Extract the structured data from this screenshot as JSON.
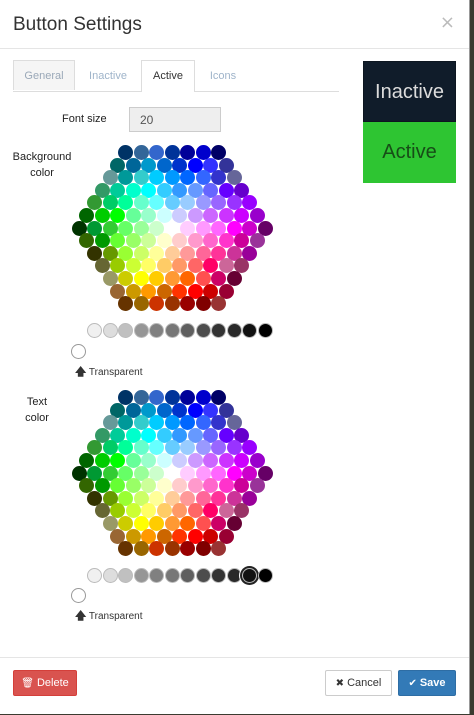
{
  "dialog": {
    "title": "Button Settings",
    "close_glyph": "×"
  },
  "tabs": [
    {
      "label": "General",
      "state": "inactive"
    },
    {
      "label": "Inactive",
      "state": "plain"
    },
    {
      "label": "Active",
      "state": "selected"
    },
    {
      "label": "Icons",
      "state": "plain"
    }
  ],
  "font_size": {
    "label": "Font size",
    "value": "20"
  },
  "background_color": {
    "label_line1": "Background",
    "label_line2": "color",
    "selected": "#00AA00"
  },
  "text_color": {
    "label_line1": "Text",
    "label_line2": "color",
    "selected": "#111111"
  },
  "transparent_label": "Transparent",
  "preview": {
    "inactive_label": "Inactive",
    "active_label": "Active",
    "inactive_bg": "#101C2A",
    "active_bg": "#2EC532"
  },
  "palette_rows": [
    [
      "#003366",
      "#336699",
      "#3366CC",
      "#003399",
      "#000099",
      "#0000CC",
      "#000066"
    ],
    [
      "#006666",
      "#006699",
      "#0099CC",
      "#0066CC",
      "#0033CC",
      "#0000FF",
      "#3333FF",
      "#333399"
    ],
    [
      "#669999",
      "#009999",
      "#33CCCC",
      "#00CCFF",
      "#0099FF",
      "#0066FF",
      "#3366FF",
      "#3333CC",
      "#666699"
    ],
    [
      "#339966",
      "#00CC99",
      "#00FFCC",
      "#00FFFF",
      "#33CCFF",
      "#3399FF",
      "#6699FF",
      "#6666FF",
      "#6600FF",
      "#6600CC"
    ],
    [
      "#339933",
      "#00CC66",
      "#00FF99",
      "#66FFCC",
      "#66FFFF",
      "#66CCFF",
      "#99CCFF",
      "#9999FF",
      "#9966FF",
      "#9933FF",
      "#9900FF"
    ],
    [
      "#006600",
      "#00CC00",
      "#00FF00",
      "#66FF99",
      "#99FFCC",
      "#CCFFFF",
      "#CCCCFF",
      "#CC99FF",
      "#CC66FF",
      "#CC33FF",
      "#CC00FF",
      "#9900CC"
    ],
    [
      "#003300",
      "#009933",
      "#33CC33",
      "#66FF66",
      "#99FF99",
      "#CCFFCC",
      "#FFFFFF",
      "#FFCCFF",
      "#FF99FF",
      "#FF66FF",
      "#FF00FF",
      "#CC00CC",
      "#660066"
    ],
    [
      "#336600",
      "#009900",
      "#66FF33",
      "#99FF66",
      "#CCFF99",
      "#FFFFCC",
      "#FFCCCC",
      "#FF99CC",
      "#FF66CC",
      "#FF33CC",
      "#CC0099",
      "#993399"
    ],
    [
      "#333300",
      "#669900",
      "#99FF33",
      "#CCFF66",
      "#FFFF99",
      "#FFCC99",
      "#FF9999",
      "#FF6699",
      "#FF3399",
      "#CC3399",
      "#990099"
    ],
    [
      "#666633",
      "#99CC00",
      "#CCFF33",
      "#FFFF66",
      "#FFCC66",
      "#FF9966",
      "#FF6666",
      "#FF0066",
      "#CC6699",
      "#993366"
    ],
    [
      "#999966",
      "#CCCC00",
      "#FFFF00",
      "#FFCC00",
      "#FF9933",
      "#FF6600",
      "#FF5050",
      "#CC0066",
      "#660033"
    ],
    [
      "#996633",
      "#CC9900",
      "#FF9900",
      "#CC6600",
      "#FF3300",
      "#FF0000",
      "#CC0000",
      "#990033"
    ],
    [
      "#663300",
      "#996600",
      "#CC3300",
      "#993300",
      "#990000",
      "#800000",
      "#993333"
    ]
  ],
  "grays": [
    "#F0F0F0",
    "#DDDDDD",
    "#C0C0C0",
    "#969696",
    "#808080",
    "#777777",
    "#5F5F5F",
    "#4D4D4D",
    "#333333",
    "#292929",
    "#111111",
    "#000000"
  ]
}
